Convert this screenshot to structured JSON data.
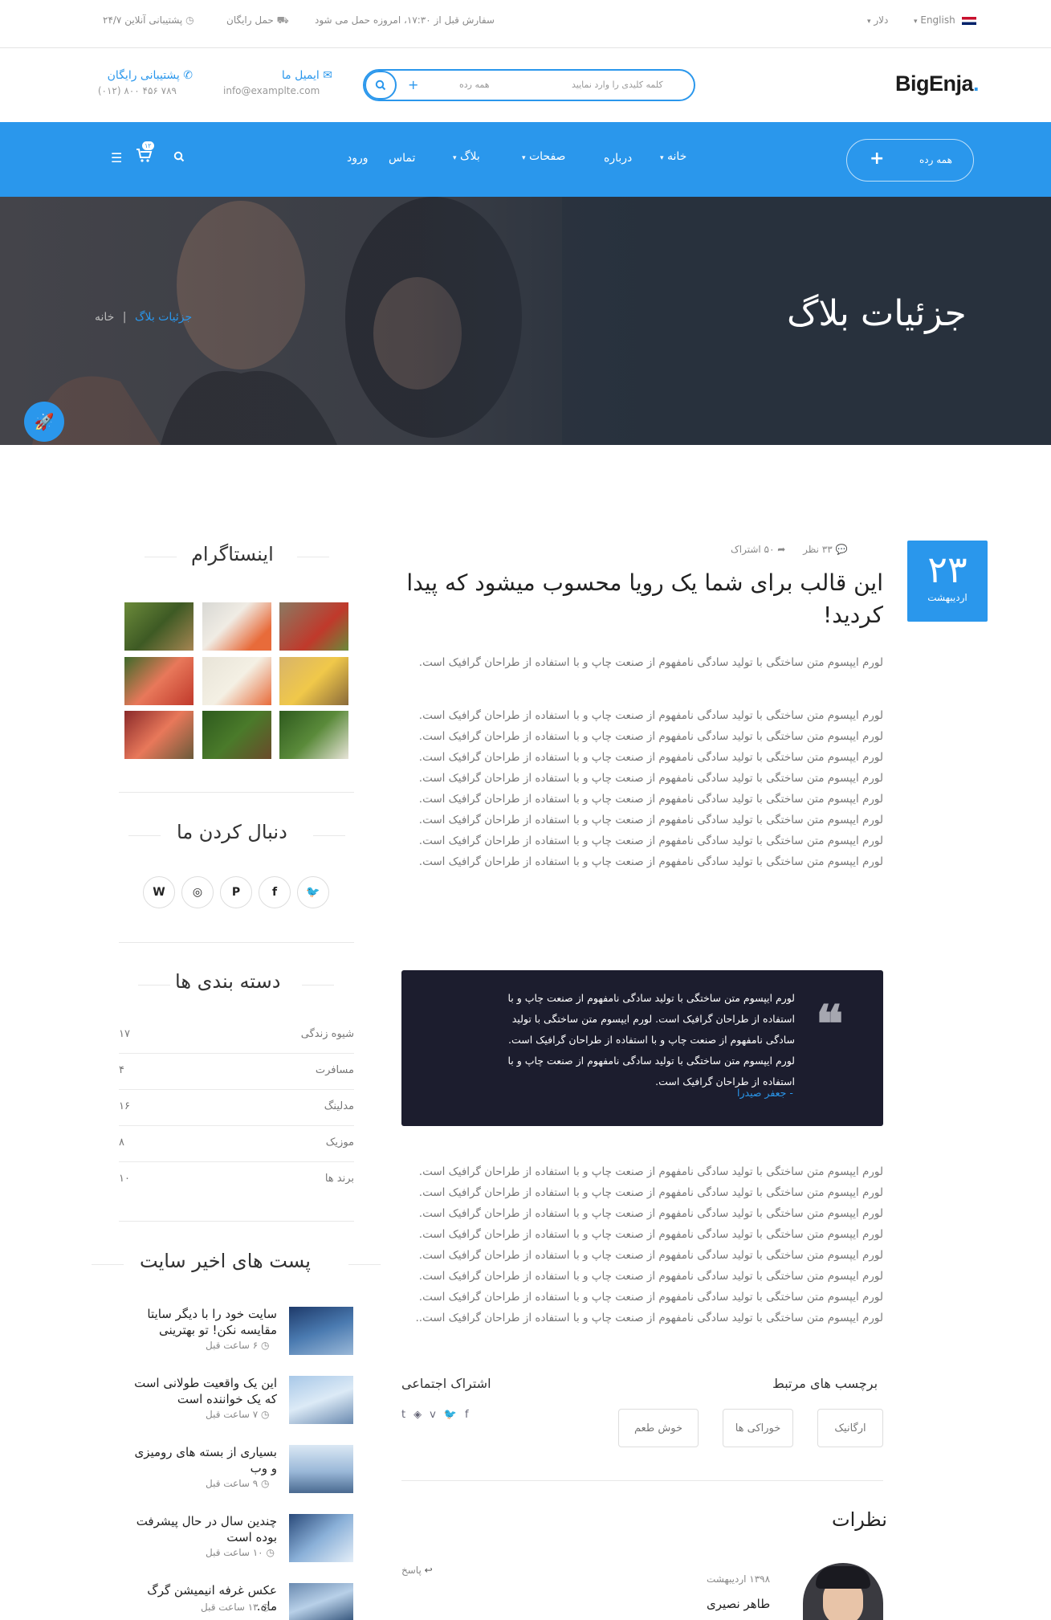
{
  "topbar": {
    "support_247": "۲۴/۷ پشتیبانی آنلاین",
    "free_shipping": "حمل رایگان",
    "order_note": "سفارش قبل از ۱۷:۳۰، امروزه حمل می شود",
    "currency": "دلار",
    "language": "English"
  },
  "header": {
    "logo": "BigEnja",
    "logo_dot": ".",
    "search_placeholder": "کلمه کلیدی را وارد نمایید",
    "search_category": "همه رده",
    "email_label": "ایمیل ما",
    "email_value": "info@examplte.com",
    "phone_label": "پشتیبانی رایگان",
    "phone_value": "(۰۱۲) ۸۰۰ ۴۵۶ ۷۸۹"
  },
  "nav": {
    "all_categories": "همه رده",
    "items": [
      "خانه",
      "درباره",
      "صفحات",
      "بلاگ",
      "تماس",
      "ورود"
    ],
    "cart_count": "۱۲"
  },
  "hero": {
    "title": "جزئیات بلاگ",
    "crumb_home": "خانه",
    "crumb_sep": "|",
    "crumb_current": "جزئیات بلاگ"
  },
  "post": {
    "day": "۲۳",
    "month": "اردیبهشت",
    "comments": "۳۳ نظر",
    "shares": "۵۰ اشتراک",
    "title": "این قالب برای شما یک رویا محسوب میشود که پیدا کردید!",
    "para1": "لورم ایپسوم متن ساختگی با تولید سادگی نامفهوم از صنعت چاپ و با استفاده از طراحان گرافیک است.",
    "para2": "لورم ایپسوم متن ساختگی با تولید سادگی نامفهوم از صنعت چاپ و با استفاده از طراحان گرافیک است. لورم ایپسوم متن ساختگی با تولید سادگی نامفهوم از صنعت چاپ و با استفاده از طراحان گرافیک است. لورم ایپسوم متن ساختگی با تولید سادگی نامفهوم از صنعت چاپ و با استفاده از طراحان گرافیک است. لورم ایپسوم متن ساختگی با تولید سادگی نامفهوم از صنعت چاپ و با استفاده از طراحان گرافیک است. لورم ایپسوم متن ساختگی با تولید سادگی نامفهوم از صنعت چاپ و با استفاده از طراحان گرافیک است. لورم ایپسوم متن ساختگی با تولید سادگی نامفهوم از صنعت چاپ و با استفاده از طراحان گرافیک است. لورم ایپسوم متن ساختگی با تولید سادگی نامفهوم از صنعت چاپ و با استفاده از طراحان گرافیک است. لورم ایپسوم متن ساختگی با تولید سادگی نامفهوم از صنعت چاپ و با استفاده از طراحان گرافیک است.",
    "quote": "لورم ایپسوم متن ساختگی با تولید سادگی نامفهوم از صنعت چاپ و با استفاده از طراحان گرافیک است. لورم ایپسوم متن ساختگی با تولید سادگی نامفهوم از صنعت چاپ و با استفاده از طراحان گرافیک است. لورم ایپسوم متن ساختگی با تولید سادگی نامفهوم از صنعت چاپ و با استفاده از طراحان گرافیک است.",
    "quote_author": "- جعفر صیدرا",
    "para3": "لورم ایپسوم متن ساختگی با تولید سادگی نامفهوم از صنعت چاپ و با استفاده از طراحان گرافیک است. لورم ایپسوم متن ساختگی با تولید سادگی نامفهوم از صنعت چاپ و با استفاده از طراحان گرافیک است. لورم ایپسوم متن ساختگی با تولید سادگی نامفهوم از صنعت چاپ و با استفاده از طراحان گرافیک است. لورم ایپسوم متن ساختگی با تولید سادگی نامفهوم از صنعت چاپ و با استفاده از طراحان گرافیک است. لورم ایپسوم متن ساختگی با تولید سادگی نامفهوم از صنعت چاپ و با استفاده از طراحان گرافیک است. لورم ایپسوم متن ساختگی با تولید سادگی نامفهوم از صنعت چاپ و با استفاده از طراحان گرافیک است. لورم ایپسوم متن ساختگی با تولید سادگی نامفهوم از صنعت چاپ و با استفاده از طراحان گرافیک است. لورم ایپسوم متن ساختگی با تولید سادگی نامفهوم از صنعت چاپ و با استفاده از طراحان گرافیک است..",
    "tags_title": "برچسب های مرتبط",
    "tags": [
      "ارگانیک",
      "خوراکی ها",
      "خوش طعم"
    ],
    "share_title": "اشتراک اجتماعی"
  },
  "comments": {
    "title": "نظرات",
    "items": [
      {
        "date": "۱۳۹۸ اردیبهشت",
        "name": "طاهر نصیری",
        "reply": "پاسخ"
      }
    ]
  },
  "sidebar": {
    "instagram_title": "اینستاگرام",
    "follow_title": "دنبال کردن ما",
    "categories_title": "دسته بندی ها",
    "categories": [
      {
        "name": "شیوه زندگی",
        "count": "۱۷"
      },
      {
        "name": "مسافرت",
        "count": "۴"
      },
      {
        "name": "مدلینگ",
        "count": "۱۶"
      },
      {
        "name": "موزیک",
        "count": "۸"
      },
      {
        "name": "برند ها",
        "count": "۱۰"
      }
    ],
    "recent_title": "پست های اخیر سایت",
    "recent_posts": [
      {
        "title": "سایت خود را با دیگر سایتا مقایسه نکن! تو بهترینی",
        "time": "۶ ساعت قبل"
      },
      {
        "title": "این یک واقعیت طولانی است که یک خواننده است",
        "time": "۷ ساعت قبل"
      },
      {
        "title": "بسیاری از بسته های رومیزی و وب",
        "time": "۹ ساعت قبل"
      },
      {
        "title": "چندین سال در حال پیشرفت بوده است",
        "time": "۱۰ ساعت قبل"
      },
      {
        "title": "عکس غرفه انیمیشن گرگ ماه.",
        "time": "۱۳ ساعت قبل"
      }
    ]
  },
  "colors": {
    "accent": "#2a97ec",
    "quote_bg": "#1c1d2e"
  }
}
